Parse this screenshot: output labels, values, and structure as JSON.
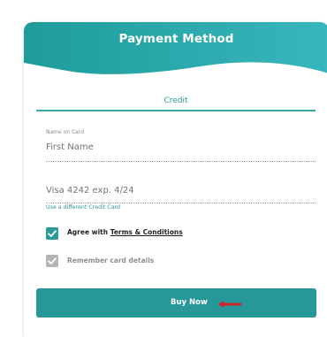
{
  "header": {
    "title": "Payment Method"
  },
  "tabs": {
    "credit_label": "Credit"
  },
  "name_field": {
    "label": "Name on Card",
    "placeholder": "First Name"
  },
  "card_field": {
    "placeholder": "Visa 4242 exp. 4/24"
  },
  "links": {
    "different_card": "Use a different Credit Card"
  },
  "agree": {
    "text": "Agree with ",
    "terms_link": "Terms & Conditions",
    "checked": true
  },
  "remember": {
    "text": "Remember card details",
    "checked": true
  },
  "buy_button": {
    "label": "Buy Now"
  },
  "colors": {
    "teal": "#27979a",
    "teal_light": "#3aa7a6",
    "arrow_red": "#d42020"
  },
  "icons": {
    "checkmark": "check-icon",
    "arrow": "arrow-left-icon"
  }
}
